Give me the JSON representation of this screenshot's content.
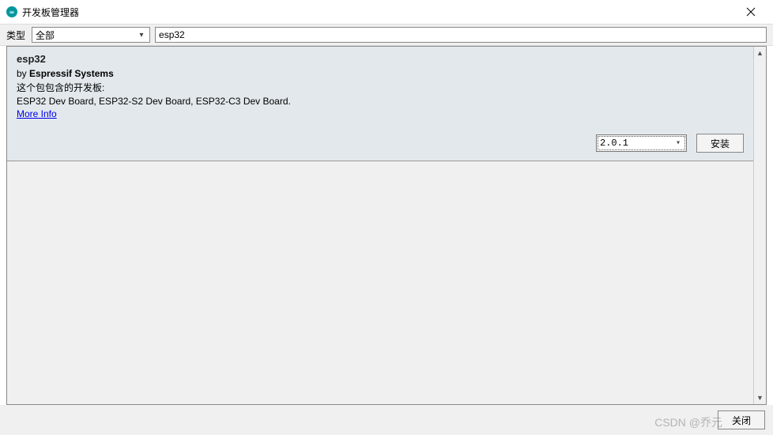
{
  "window": {
    "title": "开发板管理器",
    "icon_label": "∞"
  },
  "filter": {
    "type_label": "类型",
    "type_value": "全部",
    "search_value": "esp32"
  },
  "package": {
    "name": "esp32",
    "by_prefix": "by ",
    "author": "Espressif Systems",
    "desc_label": "这个包包含的开发板:",
    "boards": "ESP32 Dev Board, ESP32-S2 Dev Board, ESP32-C3 Dev Board.",
    "more_info": "More Info",
    "version": "2.0.1",
    "install_label": "安装"
  },
  "footer": {
    "close_label": "关闭"
  },
  "watermark": "CSDN @乔元"
}
